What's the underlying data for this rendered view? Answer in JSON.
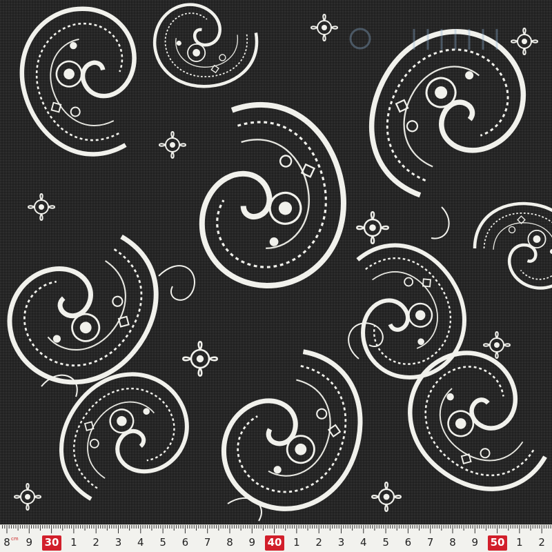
{
  "image": {
    "subject": "paisley fabric swatch",
    "palette": {
      "ground": "#262626",
      "print": "#f1f1ec",
      "ruler": "#f2f2ee",
      "ruler_accent": "#d21f2b"
    }
  },
  "ruler": {
    "unit": "cm",
    "labels": [
      "8",
      "9",
      "30",
      "1",
      "2",
      "3",
      "4",
      "5",
      "6",
      "7",
      "8",
      "9",
      "40",
      "1",
      "2",
      "3",
      "4",
      "5",
      "6",
      "7",
      "8",
      "9",
      "50",
      "1",
      "2"
    ],
    "major_labels": [
      "30",
      "40",
      "50"
    ]
  }
}
